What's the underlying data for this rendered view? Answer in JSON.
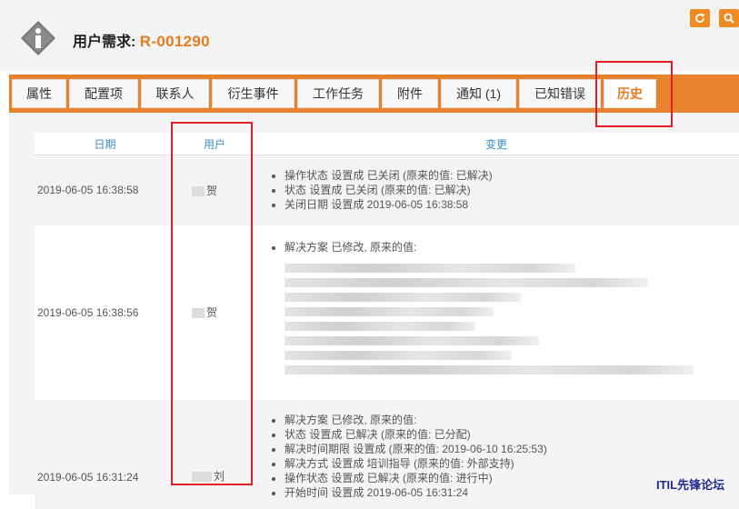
{
  "header": {
    "title_prefix": "用户需求:",
    "ticket_ref": "R-001290"
  },
  "toolbar": {
    "refresh_icon": "refresh-icon",
    "search_icon": "search-icon"
  },
  "tabs": [
    {
      "label": "属性"
    },
    {
      "label": "配置项"
    },
    {
      "label": "联系人"
    },
    {
      "label": "衍生事件"
    },
    {
      "label": "工作任务"
    },
    {
      "label": "附件"
    },
    {
      "label": "通知 (1)"
    },
    {
      "label": "已知错误"
    },
    {
      "label": "历史",
      "active": true
    }
  ],
  "history": {
    "columns": {
      "date": "日期",
      "user": "用户",
      "changes": "变更"
    },
    "rows": [
      {
        "date": "2019-06-05 16:38:58",
        "user": "贺",
        "changes": [
          "操作状态 设置成 已关闭 (原来的值: 已解决)",
          "状态 设置成 已关闭 (原来的值: 已解决)",
          "关闭日期 设置成 2019-06-05 16:38:58"
        ]
      },
      {
        "date": "2019-06-05 16:38:56",
        "user": "贺",
        "changes": [
          "解决方案 已修改, 原来的值:"
        ]
      },
      {
        "date": "2019-06-05 16:31:24",
        "user": "刘",
        "changes": [
          "解决方案 已修改, 原来的值:",
          "状态 设置成 已解决 (原来的值: 已分配)",
          "解决时间期限 设置成 (原来的值: 2019-06-10 16:25:53)",
          "解决方式 设置成 培训指导 (原来的值: 外部支持)",
          "操作状态 设置成 已解决 (原来的值: 进行中)",
          "开始时间 设置成 2019-06-05 16:31:24"
        ]
      }
    ]
  },
  "watermark": "ITIL先锋论坛",
  "colors": {
    "accent": "#e87b1e",
    "tabbar": "#e9822c",
    "highlight": "#e31e24"
  }
}
